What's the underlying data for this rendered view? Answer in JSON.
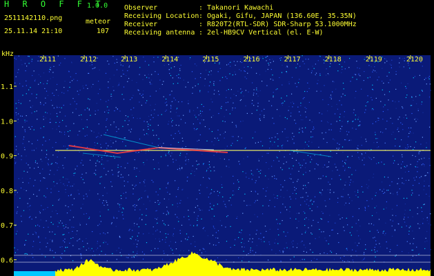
{
  "app": {
    "name": "H R O F F T",
    "version": "1.0.0"
  },
  "file": {
    "name": "2511142110.png",
    "category": "meteor",
    "timestamp": "25.11.14 21:10",
    "count": "107"
  },
  "info": {
    "rows": [
      {
        "label": "Observer",
        "value": "Takanori Kawachi"
      },
      {
        "label": "Receiving Location",
        "value": "Ogaki, Gifu, JAPAN (136.60E, 35.35N)"
      },
      {
        "label": "Receiver",
        "value": "R820T2(RTL-SDR) SDR-Sharp 53.1000MHz"
      },
      {
        "label": "Receiving antenna",
        "value": "2el-HB9CV Vertical (el. E-W)"
      }
    ],
    "separator": ":"
  },
  "spectrogram": {
    "unit": "kHz",
    "time_ticks": [
      "2111",
      "2112",
      "2113",
      "2114",
      "2115",
      "2116",
      "2117",
      "2118",
      "2119",
      "2120"
    ],
    "freq_ticks": [
      "1.1",
      "1.0",
      "0.9",
      "0.8",
      "0.7",
      "0.6"
    ],
    "carrier_khz": 0.92,
    "colors": {
      "background": "#0a1a78",
      "text": "#ffff33",
      "title": "#33ff33",
      "grid": "#ffffff",
      "carrier": "#ffff66",
      "power": "#ffff00"
    }
  }
}
